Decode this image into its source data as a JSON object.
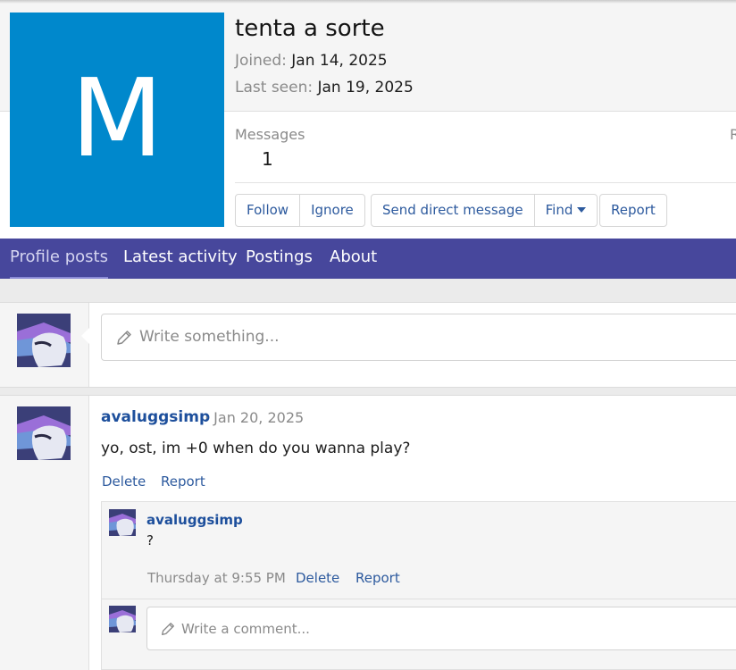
{
  "profile": {
    "avatar_letter": "M",
    "name": "tenta a sorte",
    "joined_label": "Joined:",
    "joined_value": "Jan 14, 2025",
    "last_seen_label": "Last seen:",
    "last_seen_value": "Jan 19, 2025",
    "avatar_color": "#0088cc"
  },
  "stats": {
    "messages_label": "Messages",
    "messages_value": "1",
    "cut_label": "R"
  },
  "actions": {
    "follow": "Follow",
    "ignore": "Ignore",
    "send_dm": "Send direct message",
    "find": "Find",
    "report": "Report"
  },
  "tabs": [
    {
      "label": "Profile posts"
    },
    {
      "label": "Latest activity"
    },
    {
      "label": "Postings"
    },
    {
      "label": "About"
    }
  ],
  "composer": {
    "placeholder": "Write something..."
  },
  "post": {
    "author": "avaluggsimp",
    "date": "· Jan 20, 2025",
    "text": "yo, ost, im +0 when do you wanna play?",
    "delete": "Delete",
    "report": "Report"
  },
  "comment": {
    "author": "avaluggsimp",
    "text": "?",
    "time": "Thursday at 9:55 PM",
    "delete": "Delete",
    "report": "Report",
    "placeholder": "Write a comment..."
  },
  "colors": {
    "tabbar": "#47479c",
    "link": "#2d5a9e",
    "username": "#1d4f9c"
  }
}
